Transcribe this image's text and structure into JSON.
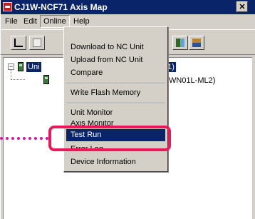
{
  "window": {
    "title": "CJ1W-NCF71 Axis Map",
    "close_glyph": "✕"
  },
  "menubar": {
    "items": [
      {
        "label": "File"
      },
      {
        "label": "Edit"
      },
      {
        "label": "Online"
      },
      {
        "label": "Help"
      }
    ]
  },
  "tree": {
    "root_label_visible": "Uni",
    "root_label_tail": "71)",
    "child_text_visible": "WN01L-ML2)"
  },
  "online_menu": {
    "items": [
      {
        "label": "Download to NC Unit"
      },
      {
        "label": "Upload from NC Unit"
      },
      {
        "label": "Compare"
      },
      {
        "label": "Write Flash Memory"
      },
      {
        "label": "Unit Monitor"
      },
      {
        "label": "Axis Monitor"
      },
      {
        "label": "Test Run"
      },
      {
        "label": "Error Log"
      },
      {
        "label": "Device Information"
      }
    ],
    "active_item": "Test Run"
  },
  "annotation": {
    "highlight_color": "#e8195a",
    "pointer_color": "#cc1aa0"
  },
  "colors": {
    "titlebar": "#0a246a",
    "selection": "#0a246a",
    "chrome": "#d4d0c8"
  },
  "icons": [
    "app-icon",
    "close-icon",
    "toolbar-icon-1",
    "toolbar-icon-2",
    "toolbar-icon-3",
    "toolbar-icon-4",
    "node-icon"
  ]
}
